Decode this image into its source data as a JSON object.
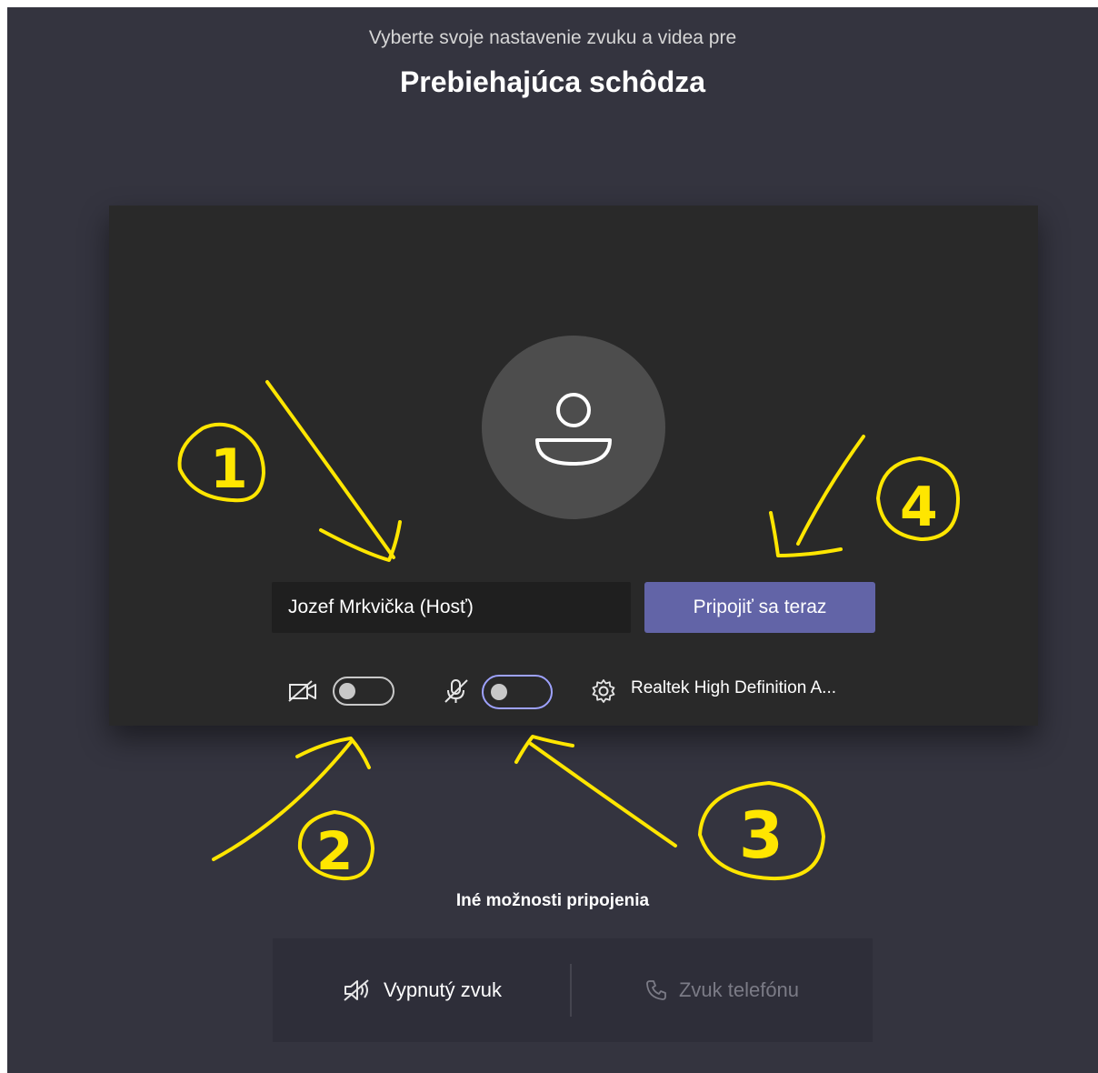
{
  "header": {
    "subtitle": "Vyberte svoje nastavenie zvuku a videa pre",
    "title": "Prebiehajúca schôdza"
  },
  "preview": {
    "avatar_icon": "person-icon",
    "name_value": "Jozef Mrkvička (Hosť)",
    "join_label": "Pripojiť sa teraz",
    "camera_toggle": {
      "icon": "camera-off-icon",
      "state": "off"
    },
    "mic_toggle": {
      "icon": "mic-off-icon",
      "state": "off"
    },
    "device_icon": "gear-icon",
    "device_label": "Realtek High Definition A..."
  },
  "other_options": {
    "title": "Iné možnosti pripojenia",
    "audio_off_label": "Vypnutý zvuk",
    "phone_audio_label": "Zvuk telefónu"
  },
  "annotations": {
    "numbers": [
      "1",
      "2",
      "3",
      "4"
    ],
    "color": "#ffe600"
  },
  "colors": {
    "background": "#34343f",
    "panel": "#292929",
    "accent": "#6264a7"
  }
}
